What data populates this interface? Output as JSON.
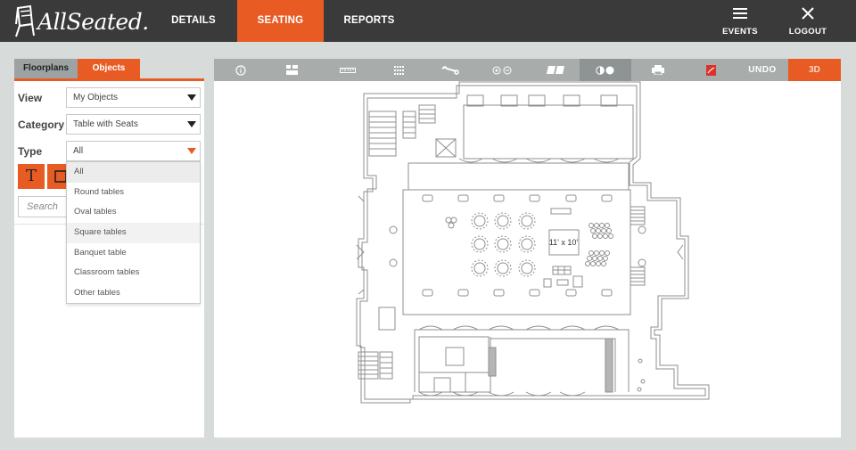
{
  "app": {
    "brand": "AllSeated.",
    "nav": [
      {
        "label": "DETAILS"
      },
      {
        "label": "SEATING",
        "active": true
      },
      {
        "label": "REPORTS"
      }
    ],
    "right_nav": [
      {
        "label": "EVENTS",
        "icon": "hamburger-icon"
      },
      {
        "label": "LOGOUT",
        "icon": "close-icon"
      }
    ],
    "accent_color": "#e85c24"
  },
  "left_panel": {
    "tabs": [
      {
        "label": "Floorplans"
      },
      {
        "label": "Objects",
        "active": true
      }
    ],
    "view": {
      "label": "View",
      "value": "My Objects"
    },
    "category": {
      "label": "Category",
      "value": "Table with Seats"
    },
    "type": {
      "label": "Type",
      "value": "All"
    },
    "tools": [
      {
        "icon": "text-tool-icon",
        "glyph": "T"
      },
      {
        "icon": "rectangle-tool-icon"
      }
    ],
    "search": {
      "placeholder": "Search"
    },
    "type_options": [
      "All",
      "Round tables",
      "Oval tables",
      "Square tables",
      "Banquet table",
      "Classroom tables",
      "Other tables"
    ]
  },
  "toolbar": {
    "buttons": [
      {
        "icon": "info-icon"
      },
      {
        "icon": "layout-icon"
      },
      {
        "icon": "ruler-icon"
      },
      {
        "icon": "grid-icon"
      },
      {
        "icon": "wrench-icon"
      },
      {
        "icon": "zoom-icon"
      },
      {
        "icon": "table-numbers-icon"
      },
      {
        "icon": "color-toggle-icon"
      },
      {
        "icon": "print-icon"
      },
      {
        "icon": "pdf-icon"
      }
    ],
    "undo_label": "UNDO",
    "view3d_label": "3D"
  },
  "floorplan": {
    "dimension_label": "11' x 10'"
  }
}
